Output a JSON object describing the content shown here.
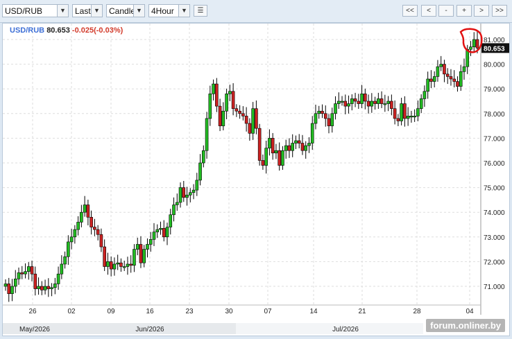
{
  "toolbar": {
    "symbol": "USD/RUB",
    "price_type": "Last",
    "chart_style": "Candle",
    "interval": "4Hour",
    "nav_buttons": [
      "<<",
      "<",
      "-",
      "+",
      ">",
      ">>"
    ]
  },
  "legend": {
    "symbol": "USD/RUB",
    "price": "80.653",
    "change": "-0.025(-0.03%)"
  },
  "colors": {
    "up": "#22bb22",
    "down": "#cc2222",
    "wick": "#000000",
    "accent_price_box": "#111111",
    "annotation": "#e11111"
  },
  "watermark": "forum.onliner.by",
  "chart_data": {
    "type": "candlestick",
    "title": "USD/RUB",
    "ylim": [
      70.5,
      81.15
    ],
    "y_ticks": [
      "71.000",
      "72.000",
      "73.000",
      "74.000",
      "75.000",
      "76.000",
      "77.000",
      "78.000",
      "79.000",
      "80.000",
      "81.000"
    ],
    "last_price_label": "80.653",
    "x_ticks": [
      "26",
      "02",
      "09",
      "16",
      "23",
      "30",
      "07",
      "14",
      "21",
      "28",
      "04"
    ],
    "month_labels": [
      "May/2026",
      "Jun/2026",
      "Jul/2026"
    ],
    "grid": true,
    "closes": [
      71.1,
      70.7,
      71.0,
      71.3,
      71.55,
      71.5,
      71.6,
      71.8,
      71.5,
      70.9,
      71.0,
      70.85,
      71.0,
      70.9,
      70.95,
      71.1,
      71.5,
      71.9,
      72.2,
      72.8,
      73.0,
      73.3,
      73.6,
      74.0,
      74.3,
      73.8,
      73.4,
      73.3,
      73.1,
      72.6,
      71.8,
      72.0,
      71.7,
      71.9,
      71.95,
      71.8,
      71.8,
      71.9,
      71.85,
      72.5,
      72.7,
      71.95,
      72.5,
      72.7,
      72.9,
      73.2,
      73.3,
      73.35,
      73.0,
      73.4,
      73.9,
      74.3,
      74.4,
      75.0,
      74.6,
      74.7,
      74.8,
      74.9,
      75.3,
      76.0,
      76.5,
      77.8,
      78.8,
      79.2,
      78.3,
      77.5,
      78.1,
      78.8,
      78.9,
      78.2,
      78.1,
      78.0,
      77.9,
      77.6,
      77.2,
      78.2,
      77.4,
      76.1,
      75.9,
      76.6,
      77.0,
      76.4,
      76.5,
      75.9,
      76.5,
      76.7,
      76.5,
      76.8,
      76.9,
      76.8,
      76.5,
      76.7,
      76.8,
      77.6,
      78.0,
      78.1,
      78.0,
      77.8,
      77.5,
      78.0,
      78.4,
      78.5,
      78.5,
      78.3,
      78.4,
      78.6,
      78.5,
      78.4,
      78.8,
      78.5,
      78.3,
      78.5,
      78.4,
      78.6,
      78.4,
      78.4,
      78.5,
      78.2,
      77.8,
      77.7,
      78.4,
      77.8,
      77.9,
      77.9,
      77.9,
      78.2,
      78.6,
      78.9,
      79.4,
      79.3,
      79.5,
      79.9,
      80.0,
      79.6,
      79.5,
      79.4,
      79.3,
      79.1,
      79.7,
      79.9,
      80.6,
      80.7,
      81.0,
      80.653
    ]
  }
}
